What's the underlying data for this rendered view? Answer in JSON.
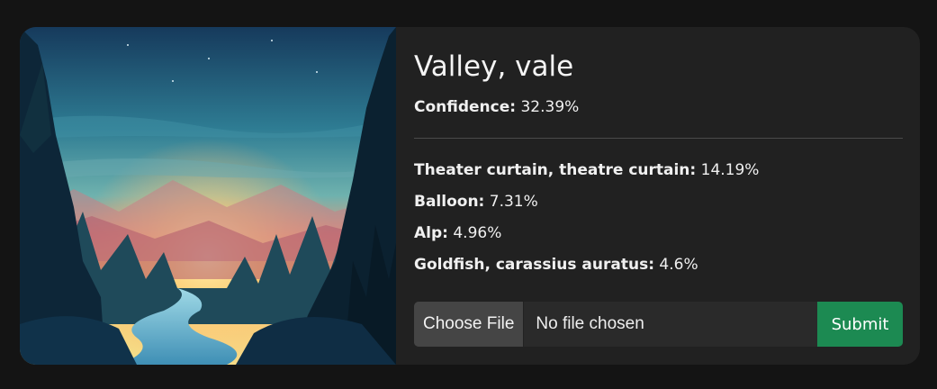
{
  "result": {
    "title": "Valley, vale",
    "confidence_label": "Confidence:",
    "confidence_value": "32.39%"
  },
  "predictions": [
    {
      "label": "Theater curtain, theatre curtain:",
      "value": "14.19%"
    },
    {
      "label": "Balloon:",
      "value": "7.31%"
    },
    {
      "label": "Alp:",
      "value": "4.96%"
    },
    {
      "label": "Goldfish, carassius auratus:",
      "value": "4.6%"
    }
  ],
  "upload": {
    "choose_label": "Choose File",
    "file_status": "No file chosen",
    "submit_label": "Submit"
  },
  "colors": {
    "page_bg": "#141414",
    "card_bg": "#212121",
    "submit_bg": "#1c8a52"
  }
}
